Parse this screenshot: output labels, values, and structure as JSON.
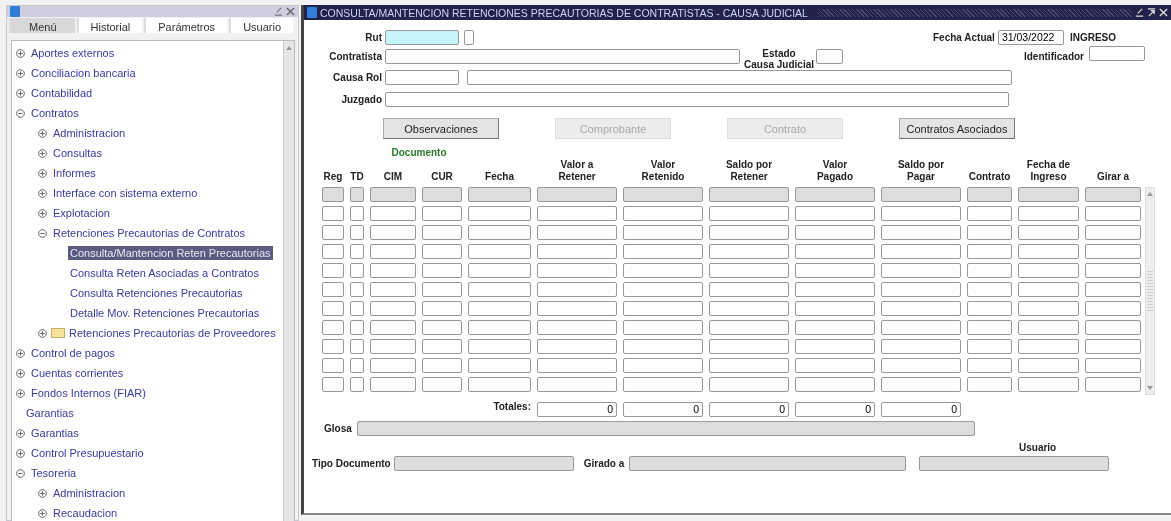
{
  "navigator": {
    "tabs": [
      {
        "label": "Menú",
        "selected": true
      },
      {
        "label": "Historial",
        "selected": false
      },
      {
        "label": "Parámetros",
        "selected": false
      },
      {
        "label": "Usuario",
        "selected": false
      }
    ],
    "tree": [
      {
        "label": "Aportes externos",
        "kind": "node",
        "expanded": false,
        "selected": false
      },
      {
        "label": "Conciliacion bancaria",
        "kind": "node",
        "expanded": false,
        "selected": false
      },
      {
        "label": "Contabilidad",
        "kind": "node",
        "expanded": false,
        "selected": false
      },
      {
        "label": "Contratos",
        "kind": "node",
        "expanded": true,
        "selected": false,
        "children": [
          {
            "label": "Administracion",
            "kind": "node",
            "expanded": false,
            "selected": false
          },
          {
            "label": "Consultas",
            "kind": "node",
            "expanded": false,
            "selected": false
          },
          {
            "label": "Informes",
            "kind": "node",
            "expanded": false,
            "selected": false
          },
          {
            "label": "Interface con sistema externo",
            "kind": "node",
            "expanded": false,
            "selected": false
          },
          {
            "label": "Explotacion",
            "kind": "node",
            "expanded": false,
            "selected": false
          },
          {
            "label": "Retenciones Precautorias de Contratos",
            "kind": "node",
            "expanded": true,
            "selected": false,
            "children": [
              {
                "label": "Consulta/Mantencion Reten Precautorias",
                "kind": "leaf",
                "selected": true
              },
              {
                "label": "Consulta Reten Asociadas a Contratos",
                "kind": "leaf",
                "selected": false
              },
              {
                "label": "Consulta Retenciones Precautorias",
                "kind": "leaf",
                "selected": false
              },
              {
                "label": "Detalle Mov. Retenciones Precautorias",
                "kind": "leaf",
                "selected": false
              }
            ]
          },
          {
            "label": "Retenciones Precautorias de Proveedores",
            "kind": "folder",
            "expanded": false,
            "selected": false
          }
        ]
      },
      {
        "label": "Control de pagos",
        "kind": "node",
        "expanded": false,
        "selected": false
      },
      {
        "label": "Cuentas corrientes",
        "kind": "node",
        "expanded": false,
        "selected": false
      },
      {
        "label": "Fondos Internos (FIAR)",
        "kind": "node",
        "expanded": false,
        "selected": false
      },
      {
        "label": "Garantias",
        "kind": "leaf",
        "selected": false
      },
      {
        "label": "Garantias",
        "kind": "node",
        "expanded": false,
        "selected": false
      },
      {
        "label": "Control Presupuestario",
        "kind": "node",
        "expanded": false,
        "selected": false
      },
      {
        "label": "Tesoreria",
        "kind": "node",
        "expanded": true,
        "selected": false,
        "children": [
          {
            "label": "Administracion",
            "kind": "node",
            "expanded": false,
            "selected": false
          },
          {
            "label": "Recaudacion",
            "kind": "node",
            "expanded": false,
            "selected": false
          }
        ]
      }
    ]
  },
  "form": {
    "title": "CONSULTA/MANTENCION RETENCIONES PRECAUTORIAS DE CONTRATISTAS - CAUSA JUDICIAL",
    "rut_label": "Rut",
    "contratista_label": "Contratista",
    "estado_label": "Estado\nCausa Judicial",
    "causa_rol_label": "Causa Rol",
    "juzgado_label": "Juzgado",
    "fecha_actual_label": "Fecha Actual",
    "fecha_actual": "31/03/2022",
    "mode": "INGRESO",
    "identificador_label": "Identificador",
    "buttons": [
      {
        "label": "Observaciones",
        "disabled": false
      },
      {
        "label": "Comprobante",
        "disabled": true
      },
      {
        "label": "Contrato",
        "disabled": true
      },
      {
        "label": "Contratos Asociados",
        "disabled": false
      }
    ],
    "group_label": "Documento",
    "columns": [
      "Reg",
      "TD",
      "CIM",
      "CUR",
      "Fecha",
      "Valor a\nRetener",
      "Valor\nRetenido",
      "Saldo por\nRetener",
      "Valor\nPagado",
      "Saldo por\nPagar",
      "Contrato",
      "Fecha de\nIngreso",
      "Girar a"
    ],
    "totals_label": "Totales:",
    "totals": [
      "0",
      "0",
      "0",
      "0",
      "0"
    ],
    "glosa_label": "Glosa",
    "usuario_label": "Usuario",
    "tipo_documento_label": "Tipo Documento",
    "girado_a_label": "Girado a"
  }
}
